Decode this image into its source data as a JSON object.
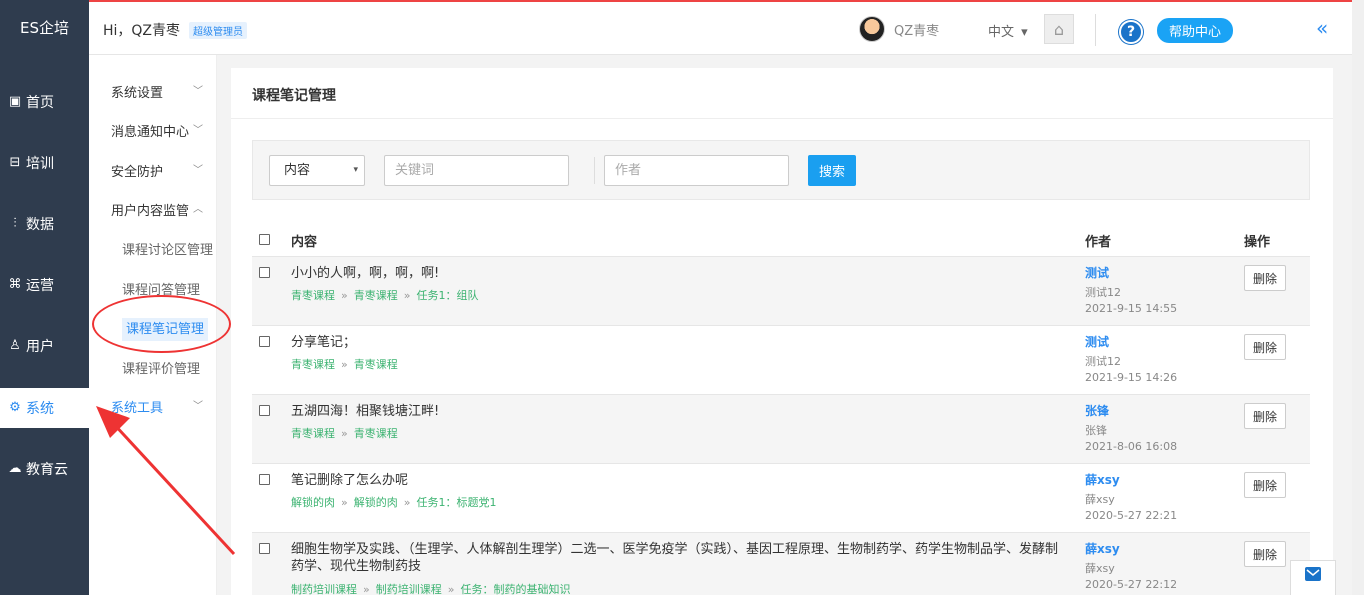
{
  "sidebar": {
    "brand": "ES企培",
    "items": [
      {
        "label": "首页",
        "icon": "monitor-icon",
        "glyph": "▣"
      },
      {
        "label": "培训",
        "icon": "training-icon",
        "glyph": "⊟"
      },
      {
        "label": "数据",
        "icon": "chart-icon",
        "glyph": "⫶"
      },
      {
        "label": "运营",
        "icon": "command-icon",
        "glyph": "⌘"
      },
      {
        "label": "用户",
        "icon": "user-icon",
        "glyph": "♙"
      },
      {
        "label": "系统",
        "icon": "gear-icon",
        "glyph": "⚙"
      },
      {
        "label": "教育云",
        "icon": "cloud-icon",
        "glyph": "☁"
      }
    ],
    "active_index": 5
  },
  "header": {
    "greeting": "Hi，QZ青枣",
    "role": "超级管理员",
    "username": "QZ青枣",
    "language": "中文",
    "language_caret": "▾",
    "home_icon": "⌂",
    "help_glyph": "?",
    "help_label": "帮助中心",
    "collapse_glyph": "«"
  },
  "submenu": {
    "groups": [
      {
        "label": "系统设置"
      },
      {
        "label": "消息通知中心"
      },
      {
        "label": "安全防护"
      },
      {
        "label": "用户内容监管"
      }
    ],
    "children": [
      {
        "label": "课程讨论区管理"
      },
      {
        "label": "课程问答管理"
      },
      {
        "label": "课程笔记管理"
      },
      {
        "label": "课程评价管理"
      }
    ],
    "tools": "系统工具",
    "chev_down": "﹀",
    "chev_up": "︿"
  },
  "main": {
    "title": "课程笔记管理",
    "filter": {
      "type_value": "内容",
      "caret": "▾",
      "keyword_placeholder": "关键词",
      "author_placeholder": "作者",
      "search_label": "搜索"
    },
    "columns": {
      "content": "内容",
      "author": "作者",
      "action": "操作"
    },
    "delete_label": "删除",
    "crumb_sep": "»",
    "rows": [
      {
        "content": "小小的人啊，啊，啊，啊!",
        "crumbs": [
          "青枣课程",
          "青枣课程",
          "任务1：组队"
        ],
        "author": "测试",
        "author_sub": "测试12",
        "time": "2021-9-15 14:55"
      },
      {
        "content": "分享笔记；",
        "crumbs": [
          "青枣课程",
          "青枣课程"
        ],
        "author": "测试",
        "author_sub": "测试12",
        "time": "2021-9-15 14:26"
      },
      {
        "content": "五湖四海！相聚钱塘江畔!",
        "crumbs": [
          "青枣课程",
          "青枣课程"
        ],
        "author": "张锋",
        "author_sub": "张锋",
        "time": "2021-8-06 16:08"
      },
      {
        "content": "笔记删除了怎么办呢",
        "crumbs": [
          "解锁的肉",
          "解锁的肉",
          "任务1：标题党1"
        ],
        "author": "薛xsy",
        "author_sub": "薛xsy",
        "time": "2020-5-27 22:21"
      },
      {
        "content": "细胞生物学及实践、（生理学、人体解剖生理学）二选一、医学免疫学（实践）、基因工程原理、生物制药学、药学生物制品学、发酵制药学、现代生物制药技",
        "crumbs": [
          "制药培训课程",
          "制药培训课程",
          "任务：制药的基础知识"
        ],
        "author": "薛xsy",
        "author_sub": "薛xsy",
        "time": "2020-5-27 22:12"
      }
    ]
  },
  "colors": {
    "accent": "#2d8cf0",
    "sidebar_bg": "#2f3c4e",
    "link_green": "#3cb371",
    "annotation_red": "#e33"
  }
}
